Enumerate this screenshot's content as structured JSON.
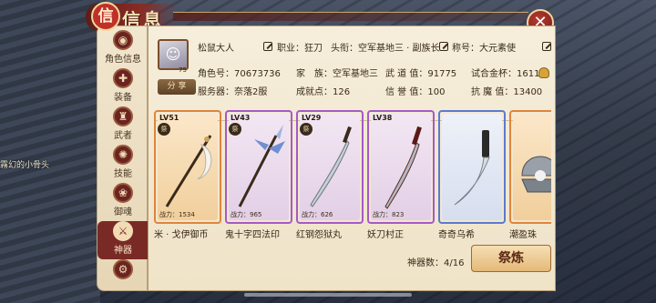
{
  "window": {
    "title": "信息"
  },
  "background": {
    "player_label": "霧幻的小骨头"
  },
  "tabs": [
    {
      "label": "角色信息",
      "icon": "character-icon",
      "glyph": "◉"
    },
    {
      "label": "装备",
      "icon": "equipment-icon",
      "glyph": "✚"
    },
    {
      "label": "武者",
      "icon": "warrior-icon",
      "glyph": "♜"
    },
    {
      "label": "技能",
      "icon": "skill-icon",
      "glyph": "✺"
    },
    {
      "label": "御魂",
      "icon": "soul-icon",
      "glyph": "❀"
    },
    {
      "label": "神器",
      "icon": "artifact-icon",
      "glyph": "⚔"
    },
    {
      "label": "",
      "icon": "settings-icon",
      "glyph": "⚙"
    }
  ],
  "active_tab": "神器",
  "profile": {
    "name": "松鼠大人",
    "avatar_level": "75",
    "job": "职业：狂刀",
    "title": "头衔：空军基地三 · 副族长",
    "nickname": "称号：大元素使",
    "role_id": "角色号：70673736",
    "family": "家　族：空军基地三",
    "martial": "武 道 值：91775",
    "trial": "试合金杯：1611",
    "server": "服务器：奈落2服",
    "achievement": "成就点：126",
    "reputation": "信 誉 值：100",
    "resistance": "抗 魔 值：13400",
    "share_label": "分 享"
  },
  "artifacts": [
    {
      "name": "米 · 戈伊御币",
      "level": "LV51",
      "power": "战力：1534",
      "rarity": "orange"
    },
    {
      "name": "鬼十字四法印",
      "level": "LV43",
      "power": "战力：965",
      "rarity": "purple"
    },
    {
      "name": "红钢怨狱丸",
      "level": "LV29",
      "power": "战力：626",
      "rarity": "purple"
    },
    {
      "name": "妖刀村正",
      "level": "LV38",
      "power": "战力：823",
      "rarity": "purple"
    },
    {
      "name": "奇奇乌希",
      "level": "",
      "power": "",
      "rarity": "blue"
    },
    {
      "name": "潮盈珠",
      "level": "",
      "power": "",
      "rarity": "orange"
    }
  ],
  "footer": {
    "count": "神器数：4/16",
    "refine_label": "祭炼"
  },
  "colors": {
    "accent_red": "#7a2a25",
    "panel_bg": "#f6eedb",
    "orange_rarity": "#e0843b",
    "purple_rarity": "#a45ac9"
  }
}
